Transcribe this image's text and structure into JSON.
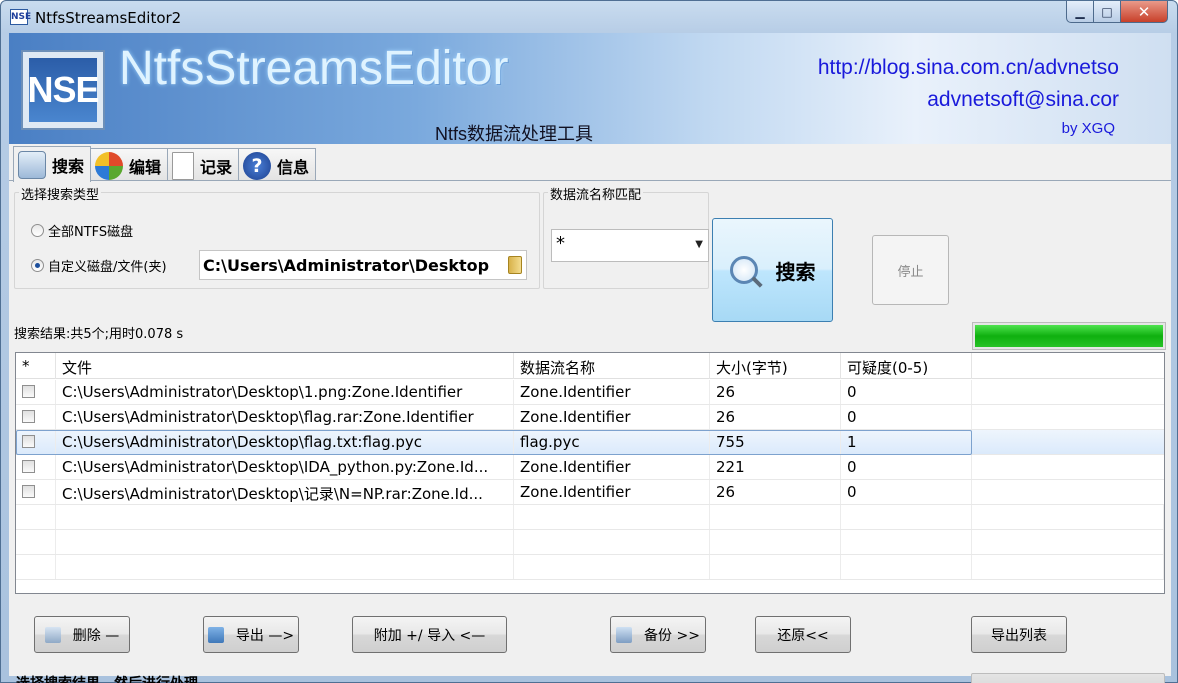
{
  "window": {
    "icon_text": "NSE",
    "title": "NtfsStreamsEditor2",
    "min": "▁",
    "max": "□",
    "close": "✕"
  },
  "banner": {
    "logo": "NSE",
    "app_name": "NtfsStreamsEditor",
    "url": "http://blog.sina.com.cn/advnetso",
    "email": "advnetsoft@sina.cor",
    "by": "by XGQ",
    "subtitle": "Ntfs数据流处理工具"
  },
  "tabs": [
    {
      "label": "搜索",
      "icon": "search-icon"
    },
    {
      "label": "编辑",
      "icon": "edit-icon"
    },
    {
      "label": "记录",
      "icon": "log-icon"
    },
    {
      "label": "信息",
      "icon": "info-icon"
    }
  ],
  "search_type": {
    "title": "选择搜索类型",
    "option_all": "全部NTFS磁盘",
    "option_custom": "自定义磁盘/文件(夹)",
    "path": "C:\\Users\\Administrator\\Desktop"
  },
  "stream_match": {
    "title": "数据流名称匹配",
    "value": "*"
  },
  "search_button": "搜索",
  "stop_button": "停止",
  "result_summary": "搜索结果:共5个;用时0.078 s",
  "progress": 1.0,
  "table": {
    "headers": [
      "*",
      "文件",
      "数据流名称",
      "大小(字节)",
      "可疑度(0-5)",
      ""
    ],
    "rows": [
      {
        "file": "C:\\Users\\Administrator\\Desktop\\1.png:Zone.Identifier",
        "stream": "Zone.Identifier",
        "size": "26",
        "sus": "0"
      },
      {
        "file": "C:\\Users\\Administrator\\Desktop\\flag.rar:Zone.Identifier",
        "stream": "Zone.Identifier",
        "size": "26",
        "sus": "0"
      },
      {
        "file": "C:\\Users\\Administrator\\Desktop\\flag.txt:flag.pyc",
        "stream": "flag.pyc",
        "size": "755",
        "sus": "1"
      },
      {
        "file": "C:\\Users\\Administrator\\Desktop\\IDA_python.py:Zone.Id...",
        "stream": "Zone.Identifier",
        "size": "221",
        "sus": "0"
      },
      {
        "file": "C:\\Users\\Administrator\\Desktop\\记录\\N=NP.rar:Zone.Id...",
        "stream": "Zone.Identifier",
        "size": "26",
        "sus": "0"
      }
    ]
  },
  "buttons": {
    "delete": "删除 —",
    "export": "导出 —>",
    "attach": "附加 +/ 导入 <—",
    "backup": "备份  >>",
    "restore": "还原<<",
    "export_list": "导出列表"
  },
  "status": "选择搜索结果，然后进行处理",
  "colors": {
    "accent": "#1a1adb",
    "progress": "#0fb00f",
    "selection": "#dbeafb"
  }
}
